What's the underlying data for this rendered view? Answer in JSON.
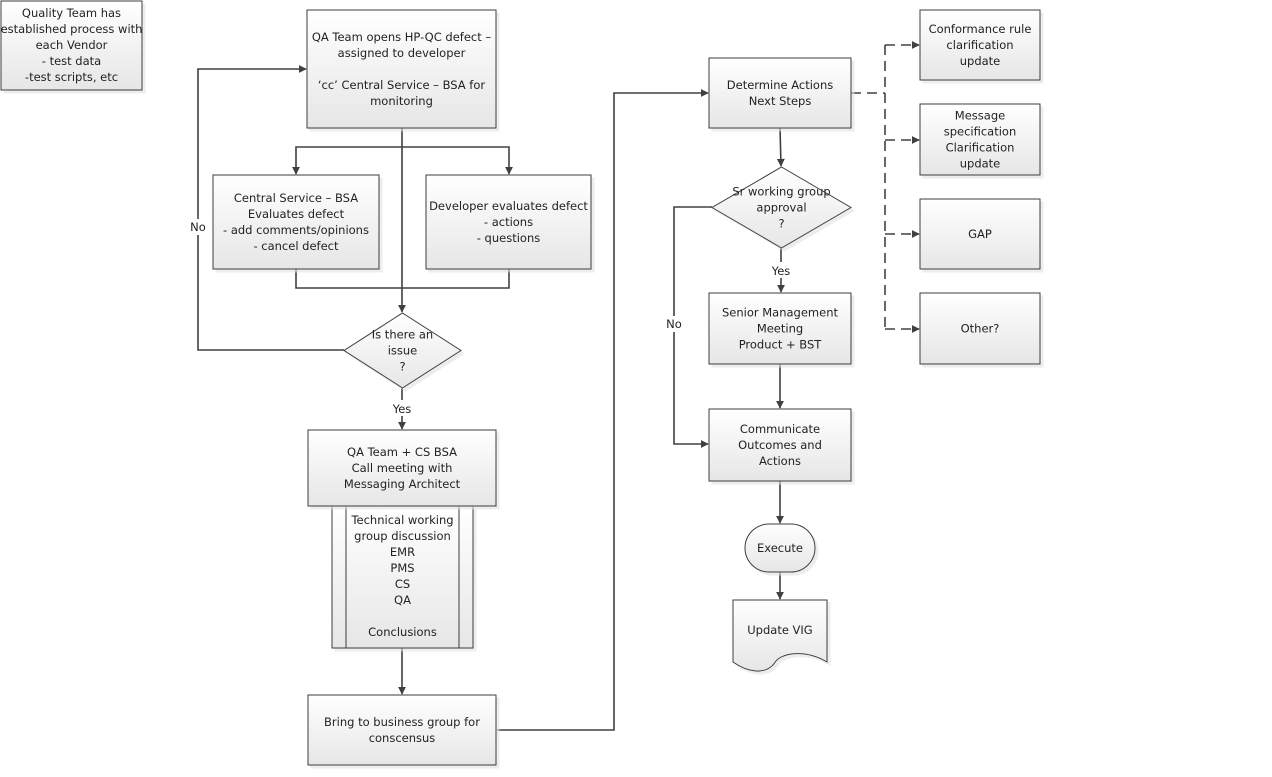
{
  "diagram": {
    "type": "flowchart",
    "colors": {
      "box_fill_top": "#ffffff",
      "box_fill_bottom": "#e8e8e8",
      "stroke": "#3c3c3c",
      "connector": "#404040",
      "text": "#222222",
      "shadow": "#d0d0d0"
    },
    "nodes": {
      "note": {
        "shape": "process",
        "lines": [
          "Quality Team has",
          "established process with",
          "each Vendor",
          "- test data",
          "-test scripts, etc"
        ]
      },
      "qa_opens": {
        "shape": "process",
        "lines": [
          "QA Team opens HP-QC defect –",
          "assigned to developer",
          "",
          "‘cc’ Central Service – BSA for",
          "monitoring"
        ]
      },
      "cs_evaluates": {
        "shape": "process",
        "lines": [
          "Central Service – BSA",
          "Evaluates defect",
          "- add comments/opinions",
          "- cancel defect"
        ]
      },
      "dev_evaluates": {
        "shape": "process",
        "lines": [
          "Developer evaluates defect",
          "- actions",
          "- questions"
        ]
      },
      "is_issue": {
        "shape": "decision",
        "lines": [
          "Is there an",
          "issue",
          "?"
        ]
      },
      "call_meeting": {
        "shape": "process",
        "lines": [
          "QA Team + CS BSA",
          "Call meeting with",
          "Messaging Architect"
        ]
      },
      "technical_group": {
        "shape": "predefined-process",
        "lines": [
          "Technical working",
          "group discussion",
          "EMR",
          "PMS",
          "CS",
          "QA",
          "",
          "Conclusions"
        ]
      },
      "business_group": {
        "shape": "process",
        "lines": [
          "Bring to business group for",
          "conscensus"
        ]
      },
      "determine_actions": {
        "shape": "process",
        "lines": [
          "Determine Actions",
          "Next Steps"
        ]
      },
      "sr_approval": {
        "shape": "decision",
        "lines": [
          "Sr working group",
          "approval",
          "?"
        ]
      },
      "senior_mgmt": {
        "shape": "process",
        "lines": [
          "Senior Management",
          "Meeting",
          "Product + BST"
        ]
      },
      "communicate": {
        "shape": "process",
        "lines": [
          "Communicate",
          "Outcomes and",
          "Actions"
        ]
      },
      "execute": {
        "shape": "terminator",
        "lines": [
          "Execute"
        ]
      },
      "update_vig": {
        "shape": "document",
        "lines": [
          "Update VIG"
        ]
      },
      "conformance": {
        "shape": "process",
        "lines": [
          "Conformance rule",
          "clarification",
          "update"
        ]
      },
      "message_spec": {
        "shape": "process",
        "lines": [
          "Message",
          "specification",
          "Clarification",
          "update"
        ]
      },
      "gap": {
        "shape": "process",
        "lines": [
          "GAP"
        ]
      },
      "other": {
        "shape": "process",
        "lines": [
          "Other?"
        ]
      }
    },
    "edges": [
      {
        "from": "qa_opens",
        "to": "cs_evaluates",
        "style": "solid"
      },
      {
        "from": "qa_opens",
        "to": "dev_evaluates",
        "style": "solid"
      },
      {
        "from": "qa_opens",
        "to": "is_issue",
        "style": "solid"
      },
      {
        "from": "cs_evaluates",
        "to": "is_issue",
        "style": "solid"
      },
      {
        "from": "dev_evaluates",
        "to": "is_issue",
        "style": "solid"
      },
      {
        "from": "is_issue",
        "to": "qa_opens",
        "label": "No",
        "style": "solid"
      },
      {
        "from": "is_issue",
        "to": "call_meeting",
        "label": "Yes",
        "style": "solid"
      },
      {
        "from": "technical_group",
        "to": "business_group",
        "style": "solid"
      },
      {
        "from": "business_group",
        "to": "determine_actions",
        "style": "solid"
      },
      {
        "from": "determine_actions",
        "to": "sr_approval",
        "style": "solid"
      },
      {
        "from": "sr_approval",
        "to": "senior_mgmt",
        "label": "Yes",
        "style": "solid"
      },
      {
        "from": "sr_approval",
        "to": "communicate",
        "label": "No",
        "style": "solid"
      },
      {
        "from": "senior_mgmt",
        "to": "communicate",
        "style": "solid"
      },
      {
        "from": "communicate",
        "to": "execute",
        "style": "solid"
      },
      {
        "from": "execute",
        "to": "update_vig",
        "style": "solid"
      },
      {
        "from": "determine_actions",
        "to": "conformance",
        "style": "dashed"
      },
      {
        "from": "determine_actions",
        "to": "message_spec",
        "style": "dashed"
      },
      {
        "from": "determine_actions",
        "to": "gap",
        "style": "dashed"
      },
      {
        "from": "determine_actions",
        "to": "other",
        "style": "dashed"
      }
    ],
    "edge_labels": {
      "no_left": "No",
      "yes_issue": "Yes",
      "yes_approval": "Yes",
      "no_approval": "No"
    }
  }
}
